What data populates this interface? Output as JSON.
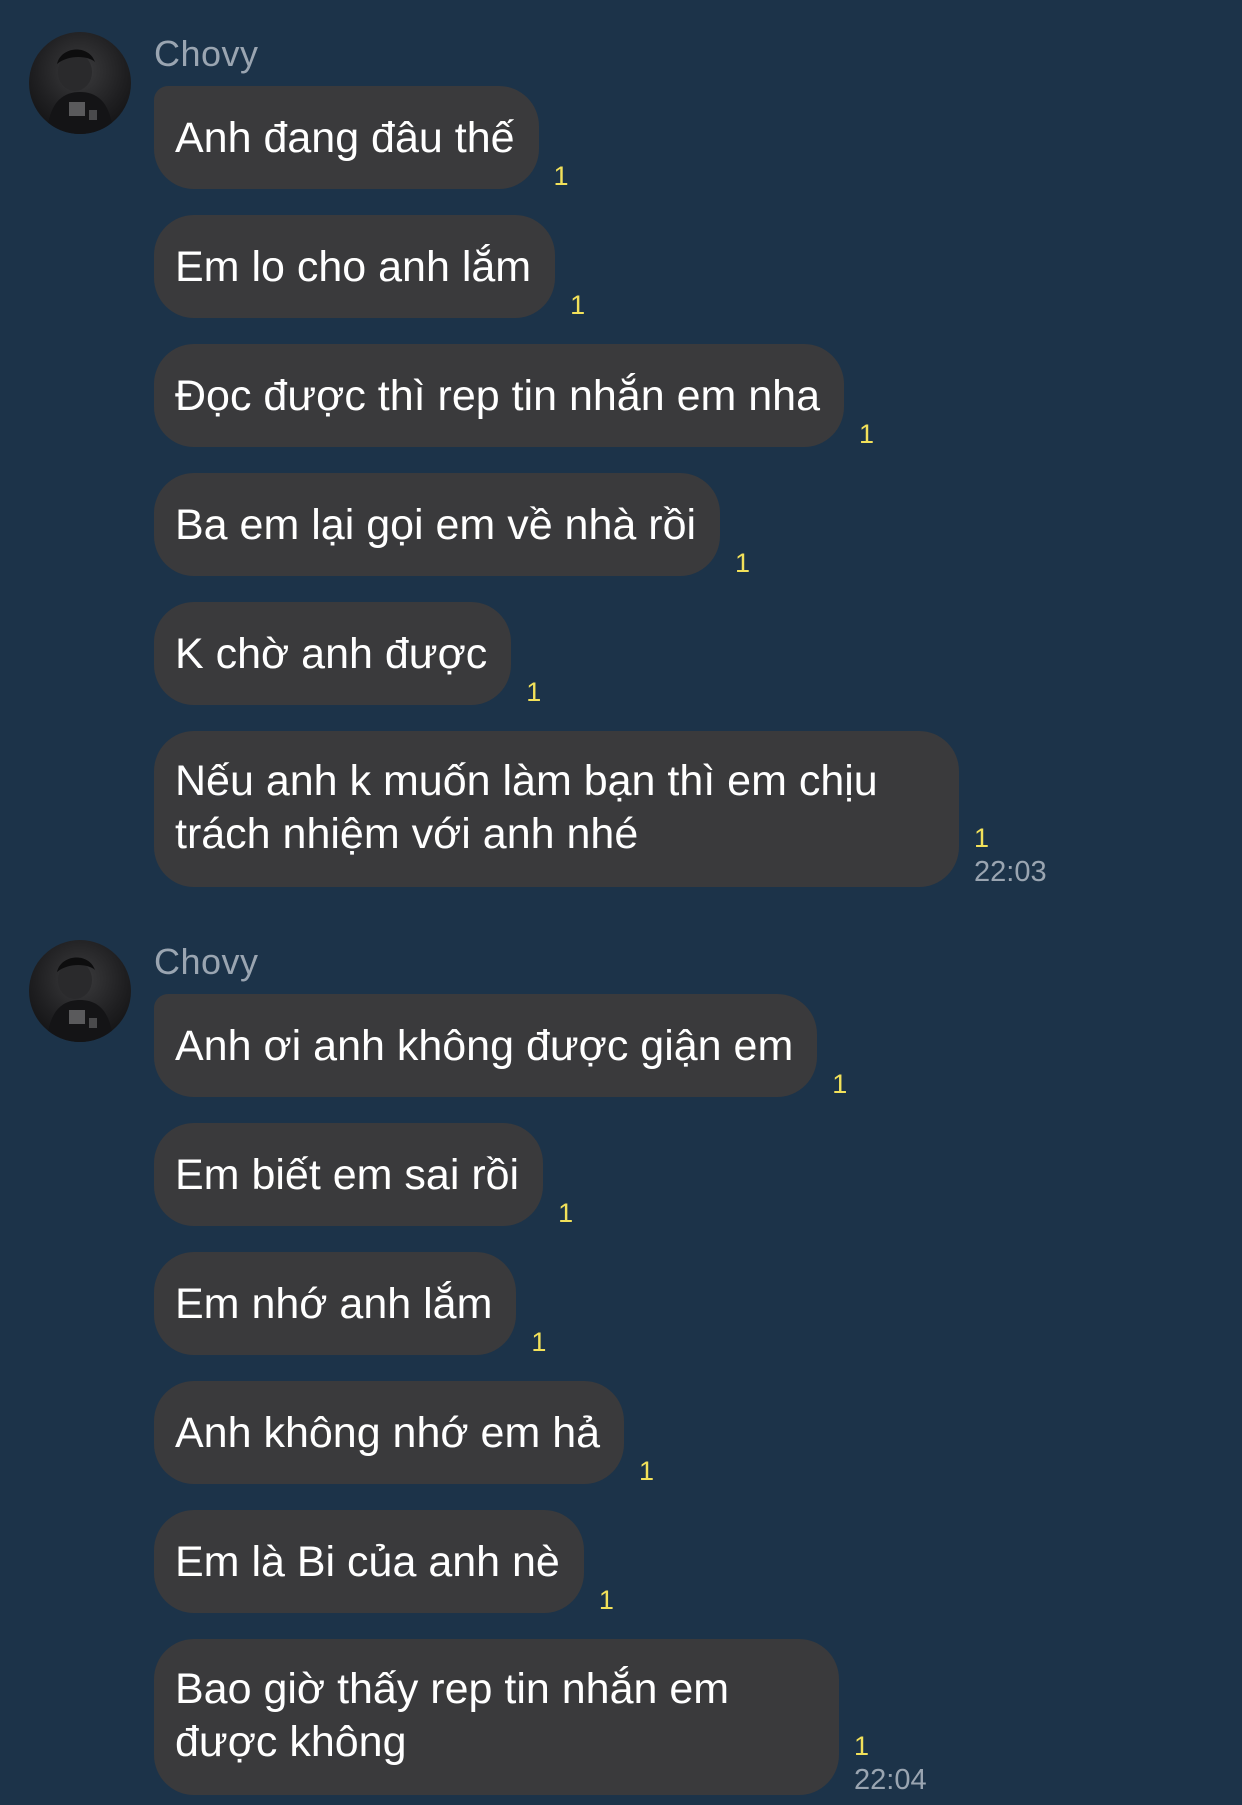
{
  "groups": [
    {
      "sender": "Chovy",
      "messages": [
        {
          "text": "Anh đang đâu thế",
          "read": "1"
        },
        {
          "text": "Em lo cho anh lắm",
          "read": "1"
        },
        {
          "text": "Đọc được thì rep tin nhắn em nha",
          "read": "1"
        },
        {
          "text": "Ba em lại gọi em về nhà rồi",
          "read": "1"
        },
        {
          "text": "K chờ anh được",
          "read": "1"
        },
        {
          "text": "Nếu anh k muốn làm bạn thì em chịu trách nhiệm với anh nhé",
          "read": "1",
          "time": "22:03"
        }
      ]
    },
    {
      "sender": "Chovy",
      "messages": [
        {
          "text": "Anh ơi anh không được giận em",
          "read": "1"
        },
        {
          "text": "Em biết em sai rồi",
          "read": "1"
        },
        {
          "text": "Em nhớ anh lắm",
          "read": "1"
        },
        {
          "text": "Anh không nhớ em hả",
          "read": "1"
        },
        {
          "text": "Em là Bi của anh nè",
          "read": "1"
        },
        {
          "text": "Bao giờ thấy rep tin nhắn em được không",
          "read": "1",
          "time": "22:04"
        }
      ]
    }
  ],
  "colors": {
    "background": "#1c3349",
    "bubble": "#3a3a3c",
    "read_indicator": "#f2e15a",
    "meta_text": "#9aa5b1"
  },
  "icons": {
    "avatar": "profile-photo"
  }
}
